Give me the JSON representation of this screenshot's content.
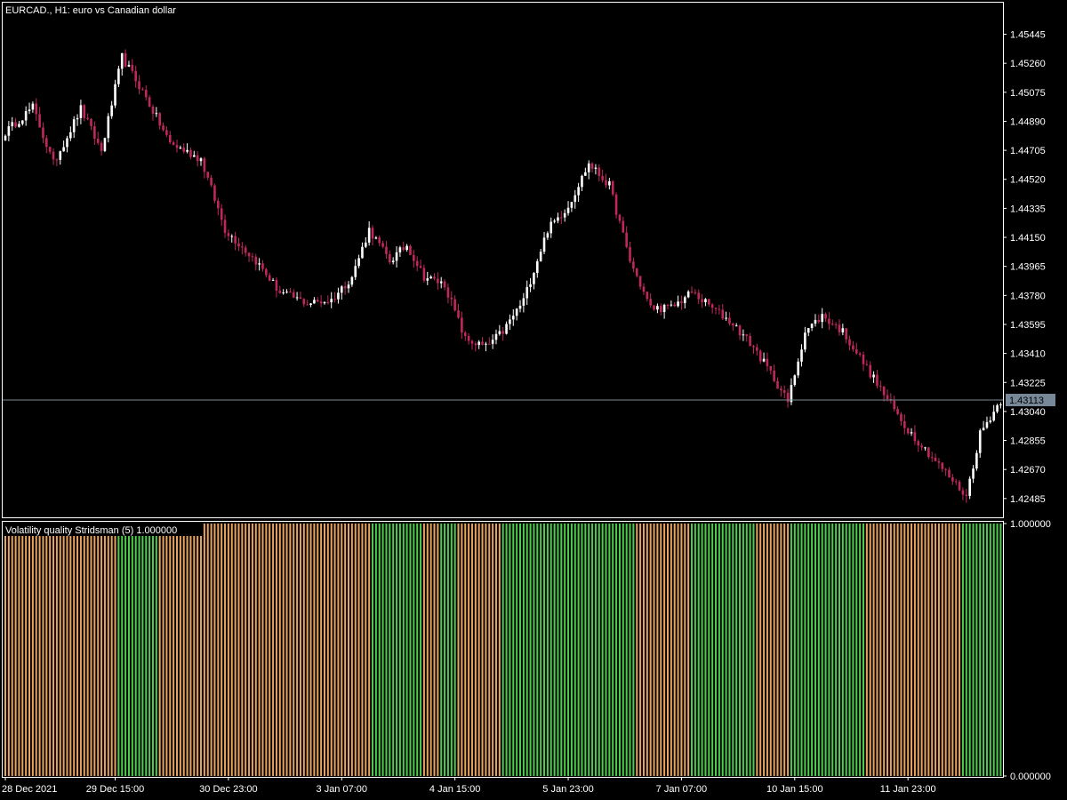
{
  "chart_data": [
    {
      "type": "candlestick",
      "title": "EURCAD., H1:  euro vs Canadian dollar",
      "yticks": [
        1.42485,
        1.4267,
        1.42855,
        1.4304,
        1.43225,
        1.4341,
        1.43595,
        1.4378,
        1.43965,
        1.4415,
        1.44335,
        1.4452,
        1.44705,
        1.4489,
        1.45075,
        1.4526,
        1.45445
      ],
      "ylim": [
        1.42365,
        1.45652
      ],
      "current_price": 1.43113,
      "current_price_label": "1.43113",
      "grid": false,
      "colors": {
        "background": "#000000",
        "bull": "#ffffff",
        "bear": "#c0285a",
        "price_line": "#778899",
        "price_label_bg": "#778899"
      },
      "anchors": [
        {
          "bar": 0,
          "close": 1.4482
        },
        {
          "bar": 8,
          "close": 1.4498
        },
        {
          "bar": 14,
          "close": 1.4462
        },
        {
          "bar": 22,
          "close": 1.4497
        },
        {
          "bar": 28,
          "close": 1.447
        },
        {
          "bar": 34,
          "close": 1.453
        },
        {
          "bar": 40,
          "close": 1.4508
        },
        {
          "bar": 48,
          "close": 1.4475
        },
        {
          "bar": 57,
          "close": 1.4465
        },
        {
          "bar": 64,
          "close": 1.442
        },
        {
          "bar": 73,
          "close": 1.44
        },
        {
          "bar": 80,
          "close": 1.438
        },
        {
          "bar": 88,
          "close": 1.4373
        },
        {
          "bar": 95,
          "close": 1.4375
        },
        {
          "bar": 101,
          "close": 1.439
        },
        {
          "bar": 106,
          "close": 1.442
        },
        {
          "bar": 112,
          "close": 1.44
        },
        {
          "bar": 117,
          "close": 1.441
        },
        {
          "bar": 122,
          "close": 1.439
        },
        {
          "bar": 128,
          "close": 1.4385
        },
        {
          "bar": 134,
          "close": 1.435
        },
        {
          "bar": 140,
          "close": 1.4345
        },
        {
          "bar": 145,
          "close": 1.4355
        },
        {
          "bar": 151,
          "close": 1.4375
        },
        {
          "bar": 158,
          "close": 1.442
        },
        {
          "bar": 164,
          "close": 1.4435
        },
        {
          "bar": 170,
          "close": 1.4462
        },
        {
          "bar": 176,
          "close": 1.4448
        },
        {
          "bar": 182,
          "close": 1.44
        },
        {
          "bar": 188,
          "close": 1.437
        },
        {
          "bar": 194,
          "close": 1.437
        },
        {
          "bar": 200,
          "close": 1.438
        },
        {
          "bar": 206,
          "close": 1.437
        },
        {
          "bar": 212,
          "close": 1.436
        },
        {
          "bar": 218,
          "close": 1.4345
        },
        {
          "bar": 224,
          "close": 1.4325
        },
        {
          "bar": 228,
          "close": 1.431
        },
        {
          "bar": 233,
          "close": 1.4355
        },
        {
          "bar": 238,
          "close": 1.4365
        },
        {
          "bar": 244,
          "close": 1.4355
        },
        {
          "bar": 250,
          "close": 1.4335
        },
        {
          "bar": 256,
          "close": 1.4315
        },
        {
          "bar": 262,
          "close": 1.4295
        },
        {
          "bar": 268,
          "close": 1.428
        },
        {
          "bar": 274,
          "close": 1.4265
        },
        {
          "bar": 280,
          "close": 1.425
        },
        {
          "bar": 284,
          "close": 1.429
        },
        {
          "bar": 290,
          "close": 1.4311
        }
      ]
    },
    {
      "type": "bar",
      "title": "Volatility quality Stridsman (5) 1.000000",
      "yticks": [
        0.0,
        1.0
      ],
      "ytick_labels": [
        "0.000000",
        "1.000000"
      ],
      "ylim": [
        0,
        1
      ],
      "colors": {
        "up": "#4ccd4c",
        "down": "#e8a35c"
      },
      "bar_count": 291,
      "segments": [
        {
          "start": 0,
          "end": 32,
          "state": "down"
        },
        {
          "start": 33,
          "end": 44,
          "state": "up"
        },
        {
          "start": 45,
          "end": 106,
          "state": "down"
        },
        {
          "start": 107,
          "end": 121,
          "state": "up"
        },
        {
          "start": 122,
          "end": 126,
          "state": "down"
        },
        {
          "start": 127,
          "end": 131,
          "state": "up"
        },
        {
          "start": 132,
          "end": 144,
          "state": "down"
        },
        {
          "start": 145,
          "end": 183,
          "state": "up"
        },
        {
          "start": 184,
          "end": 199,
          "state": "down"
        },
        {
          "start": 200,
          "end": 218,
          "state": "up"
        },
        {
          "start": 219,
          "end": 228,
          "state": "down"
        },
        {
          "start": 229,
          "end": 250,
          "state": "up"
        },
        {
          "start": 251,
          "end": 278,
          "state": "down"
        },
        {
          "start": 279,
          "end": 290,
          "state": "up"
        }
      ]
    }
  ],
  "xaxis": {
    "labels": [
      {
        "text": "28 Dec 2021",
        "bar": 0
      },
      {
        "text": "29 Dec 15:00",
        "bar": 32
      },
      {
        "text": "30 Dec 23:00",
        "bar": 65
      },
      {
        "text": "3 Jan 07:00",
        "bar": 98
      },
      {
        "text": "4 Jan 15:00",
        "bar": 131
      },
      {
        "text": "5 Jan 23:00",
        "bar": 164
      },
      {
        "text": "7 Jan 07:00",
        "bar": 197
      },
      {
        "text": "10 Jan 15:00",
        "bar": 230
      },
      {
        "text": "11 Jan 23:00",
        "bar": 263
      }
    ]
  }
}
